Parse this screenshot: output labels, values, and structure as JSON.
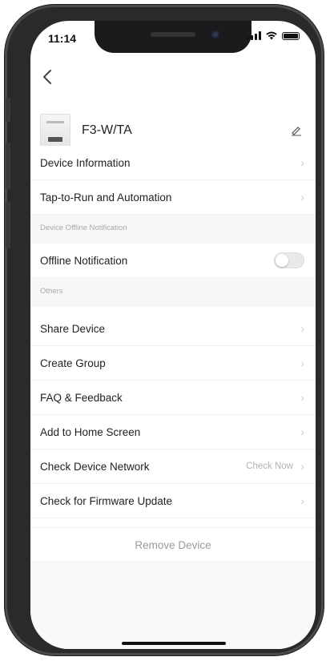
{
  "status_bar": {
    "time": "11:14"
  },
  "device": {
    "name": "F3-W/TA"
  },
  "rows": {
    "device_information": "Device Information",
    "tap_to_run": "Tap-to-Run and Automation",
    "offline_notification": "Offline Notification",
    "share_device": "Share Device",
    "create_group": "Create Group",
    "faq_feedback": "FAQ & Feedback",
    "add_home_screen": "Add to Home Screen",
    "check_network": "Check Device Network",
    "check_network_value": "Check Now",
    "firmware_update": "Check for Firmware Update"
  },
  "sections": {
    "offline": "Device Offline Notification",
    "others": "Others"
  },
  "toggles": {
    "offline_notification_on": false
  },
  "remove_label": "Remove Device",
  "icons": [
    "back-chevron-icon",
    "edit-pencil-icon",
    "chevron-right-icon",
    "signal-icon",
    "wifi-icon",
    "battery-icon"
  ]
}
